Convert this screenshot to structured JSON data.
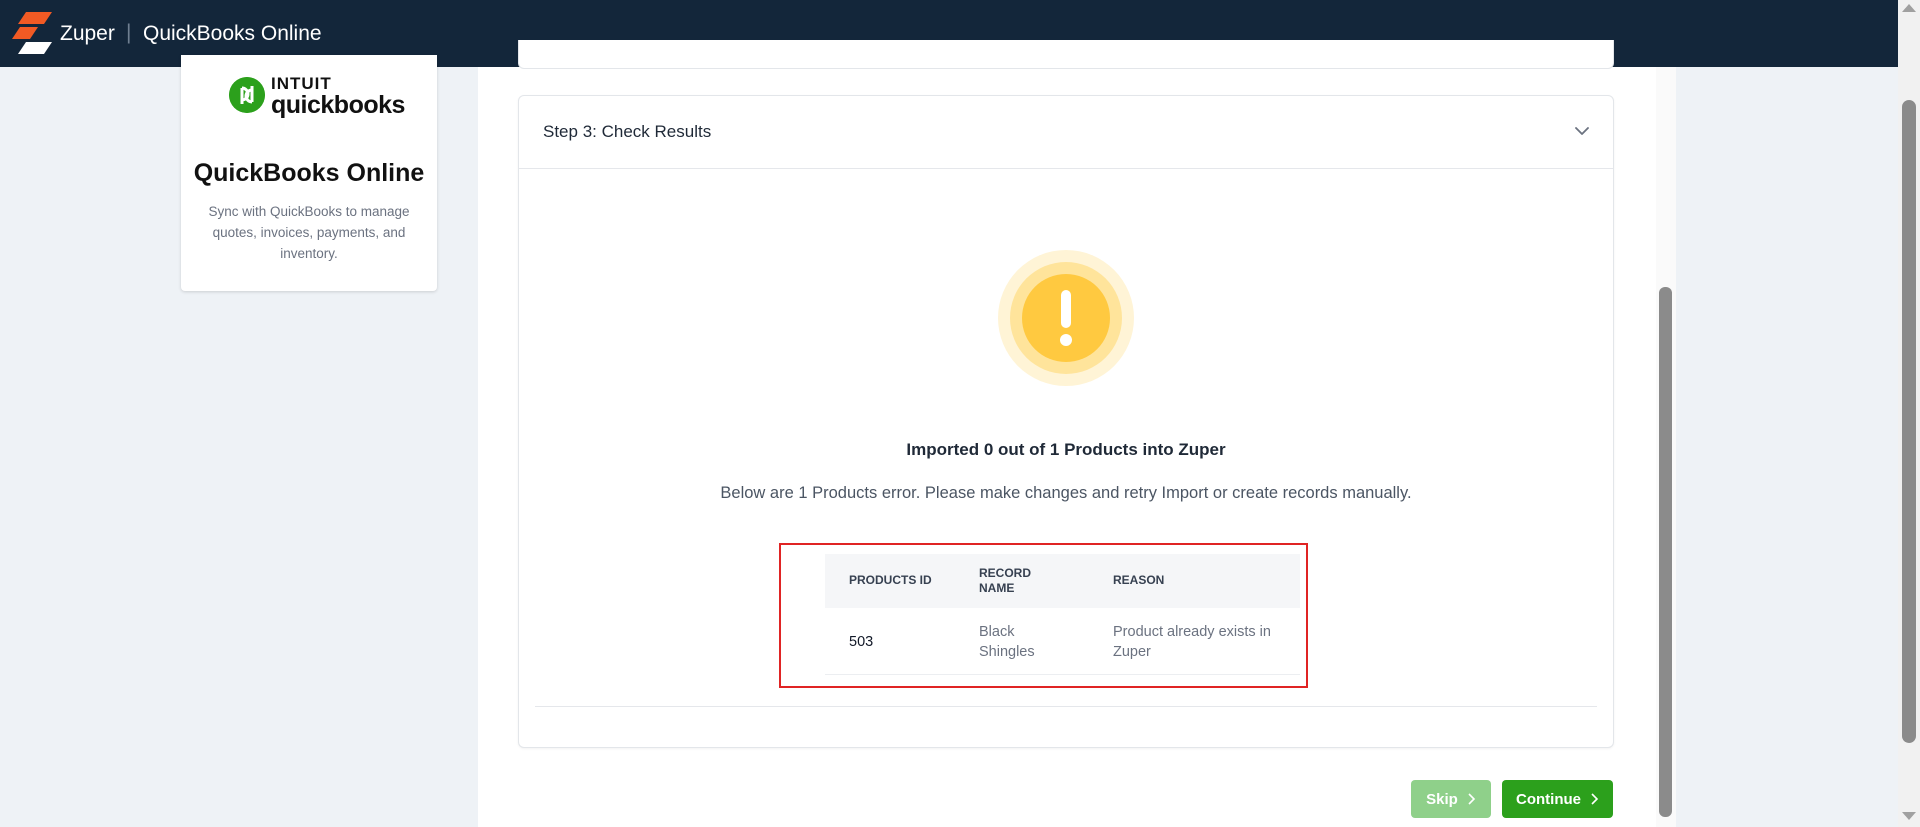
{
  "header": {
    "brand": "Zuper",
    "separator": "|",
    "app_title": "QuickBooks Online"
  },
  "integration_card": {
    "logo_top": "INTUIT",
    "logo_word": "quickbooks",
    "title": "QuickBooks Online",
    "description": "Sync with QuickBooks to manage quotes, invoices, payments, and inventory."
  },
  "step": {
    "title": "Step 3: Check Results",
    "result_title": "Imported 0 out of 1 Products into Zuper",
    "result_subtitle": "Below are 1 Products error. Please make changes and retry Import or create records manually."
  },
  "table": {
    "headers": {
      "id": "PRODUCTS ID",
      "name": "RECORD NAME",
      "reason": "REASON"
    },
    "rows": [
      {
        "id": "503",
        "name": "Black Shingles",
        "reason": "Product already exists in Zuper"
      }
    ]
  },
  "actions": {
    "skip_label": "Skip",
    "continue_label": "Continue"
  },
  "colors": {
    "header_bg": "#13263a",
    "accent_green": "#2ca01c",
    "skip_green": "#8fd08a",
    "warning_yellow": "#ffc940",
    "error_outline": "#e02424"
  }
}
